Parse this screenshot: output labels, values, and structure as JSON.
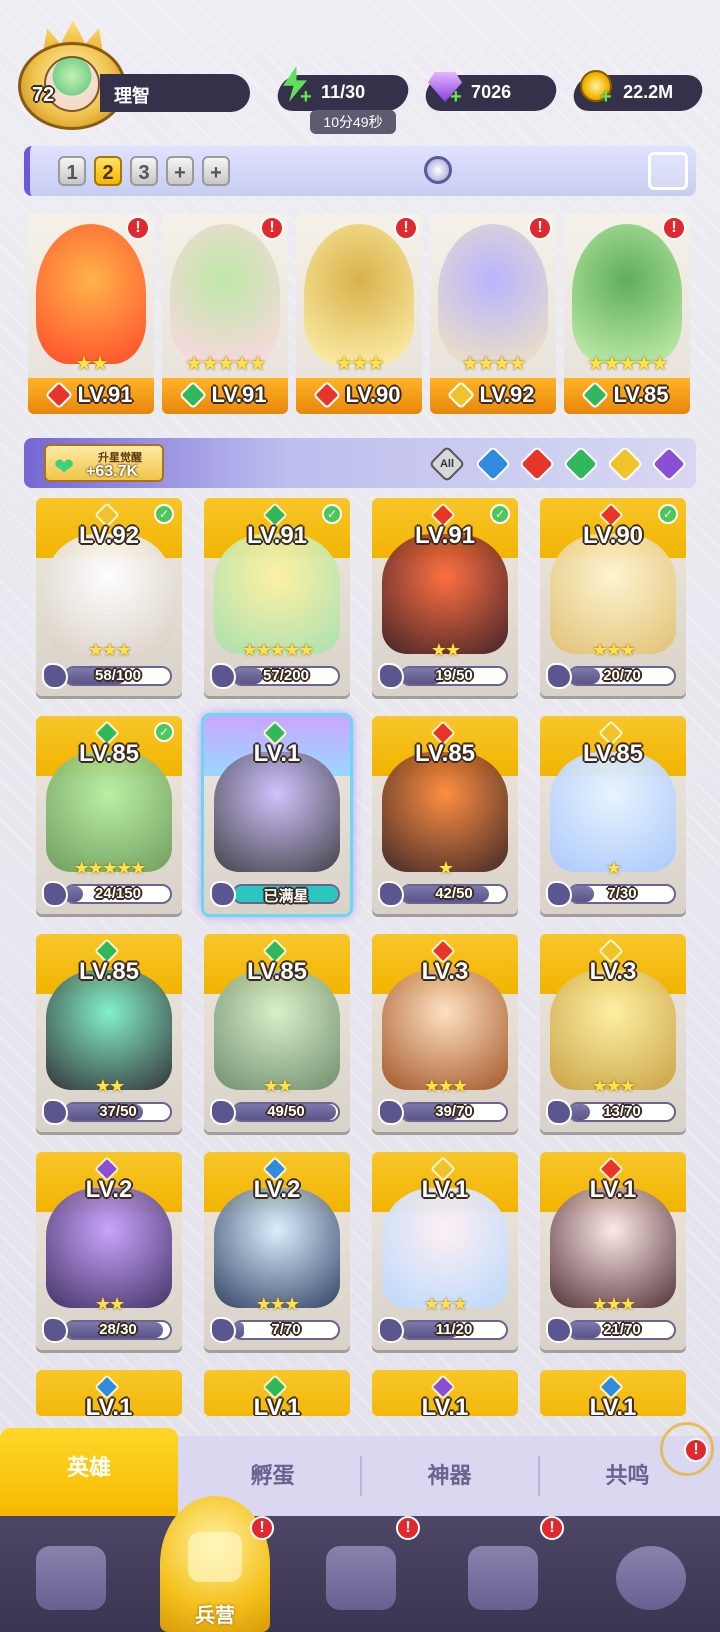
{
  "player": {
    "level": "72",
    "name": "理智"
  },
  "resources": {
    "energy": "11/30",
    "energy_timer": "10分49秒",
    "gems": "7026",
    "gold": "22.2M"
  },
  "team_tabs": [
    "1",
    "2",
    "3",
    "+",
    "+"
  ],
  "active_team_tab": 1,
  "team": [
    {
      "level": "LV.91",
      "element": "fire",
      "stars": "★★"
    },
    {
      "level": "LV.91",
      "element": "nature",
      "stars": "★★★★★"
    },
    {
      "level": "LV.90",
      "element": "fire",
      "stars": "★★★"
    },
    {
      "level": "LV.92",
      "element": "light",
      "stars": "★★★★"
    },
    {
      "level": "LV.85",
      "element": "nature",
      "stars": "★★★★★"
    }
  ],
  "awaken": {
    "title": "升星觉醒",
    "value": "+63.7K"
  },
  "filters": [
    "All",
    "water",
    "fire",
    "nature",
    "light",
    "dark"
  ],
  "colors": {
    "fire": "#e8352a",
    "nature": "#2fb85c",
    "light": "#f1c32a",
    "water": "#2f8ae0",
    "dark": "#8a4fd6"
  },
  "heroes": [
    {
      "level": "LV.92",
      "element": "light",
      "checked": true,
      "shards": "58/100",
      "progress": 0.58,
      "stars": "★★★"
    },
    {
      "level": "LV.91",
      "element": "nature",
      "checked": true,
      "shards": "57/200",
      "progress": 0.285,
      "stars": "★★★★★"
    },
    {
      "level": "LV.91",
      "element": "fire",
      "checked": true,
      "shards": "19/50",
      "progress": 0.38,
      "stars": "★★"
    },
    {
      "level": "LV.90",
      "element": "fire",
      "checked": true,
      "shards": "20/70",
      "progress": 0.286,
      "stars": "★★★"
    },
    {
      "level": "LV.85",
      "element": "nature",
      "checked": true,
      "shards": "24/150",
      "progress": 0.16,
      "stars": "★★★★★"
    },
    {
      "level": "LV.1",
      "element": "nature",
      "checked": false,
      "shards": "已满星",
      "progress": 1,
      "stars": "",
      "selected": true
    },
    {
      "level": "LV.85",
      "element": "fire",
      "checked": false,
      "shards": "42/50",
      "progress": 0.84,
      "stars": "★"
    },
    {
      "level": "LV.85",
      "element": "light",
      "checked": false,
      "shards": "7/30",
      "progress": 0.233,
      "stars": "★"
    },
    {
      "level": "LV.85",
      "element": "nature",
      "checked": false,
      "shards": "37/50",
      "progress": 0.74,
      "stars": "★★"
    },
    {
      "level": "LV.85",
      "element": "nature",
      "checked": false,
      "shards": "49/50",
      "progress": 0.98,
      "stars": "★★"
    },
    {
      "level": "LV.3",
      "element": "fire",
      "checked": false,
      "shards": "39/70",
      "progress": 0.557,
      "stars": "★★★"
    },
    {
      "level": "LV.3",
      "element": "light",
      "checked": false,
      "shards": "13/70",
      "progress": 0.186,
      "stars": "★★★"
    },
    {
      "level": "LV.2",
      "element": "dark",
      "checked": false,
      "shards": "28/30",
      "progress": 0.933,
      "stars": "★★"
    },
    {
      "level": "LV.2",
      "element": "water",
      "checked": false,
      "shards": "7/70",
      "progress": 0.1,
      "stars": "★★★"
    },
    {
      "level": "LV.1",
      "element": "light",
      "checked": false,
      "shards": "11/20",
      "progress": 0.55,
      "stars": "★★★"
    },
    {
      "level": "LV.1",
      "element": "fire",
      "checked": false,
      "shards": "21/70",
      "progress": 0.3,
      "stars": "★★★"
    },
    {
      "level": "LV.1",
      "element": "water",
      "partial": true
    },
    {
      "level": "LV.1",
      "element": "nature",
      "partial": true
    },
    {
      "level": "LV.1",
      "element": "dark",
      "partial": true
    },
    {
      "level": "LV.1",
      "element": "water",
      "partial": true
    }
  ],
  "sub_tabs": [
    "英雄",
    "孵蛋",
    "神器",
    "共鸣"
  ],
  "nav": {
    "active_label": "兵营"
  }
}
